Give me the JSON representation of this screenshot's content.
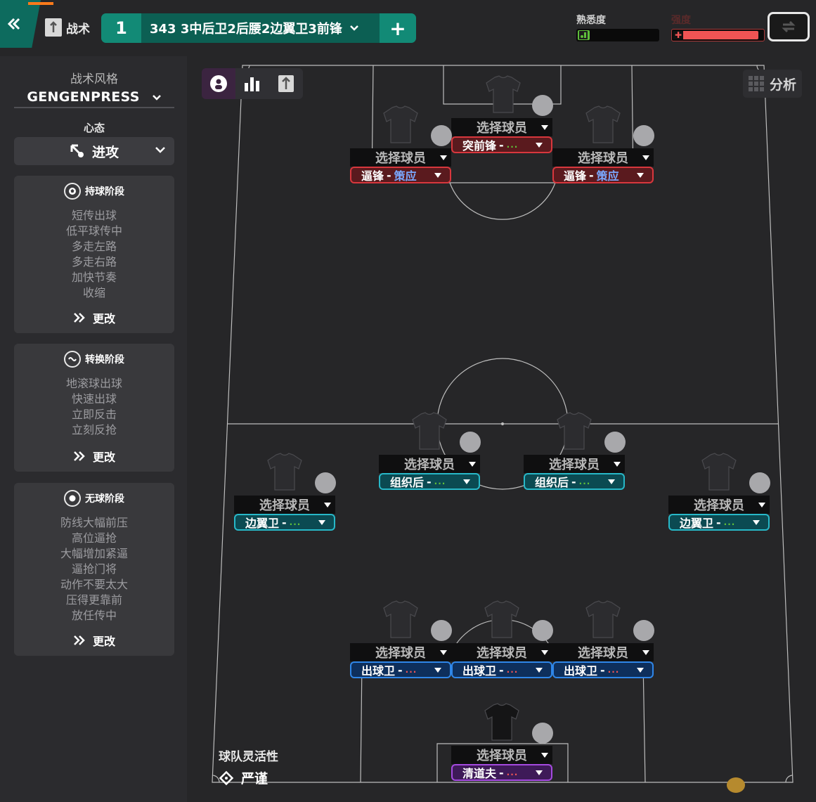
{
  "header": {
    "tab_label": "战术",
    "slot_number": "1",
    "formation_name": "343  3中后卫2后腰2边翼卫3前锋",
    "add_symbol": "+",
    "familiarity_label": "熟悉度",
    "familiarity_level": 0.15,
    "intensity_label": "强度",
    "intensity_level": 0.95,
    "accent_orange": "#ff7a1a",
    "brand_green": "#128a76"
  },
  "sidebar": {
    "style_caption": "战术风格",
    "style_value": "GENGENPRESS",
    "mentality_caption": "心态",
    "mentality_value": "进攻",
    "phases": [
      {
        "title": "持球阶段",
        "icon": "ball-icon",
        "items": [
          "短传出球",
          "低平球传中",
          "多走左路",
          "多走右路",
          "加快节奏",
          "收缩"
        ],
        "change_label": "更改"
      },
      {
        "title": "转换阶段",
        "icon": "transition-icon",
        "items": [
          "地滚球出球",
          "快速出球",
          "立即反击",
          "立刻反抢"
        ],
        "change_label": "更改"
      },
      {
        "title": "无球阶段",
        "icon": "defense-icon",
        "items": [
          "防线大幅前压",
          "高位逼抢",
          "大幅增加紧逼",
          "逼抢门将",
          "动作不要太大",
          "压得更靠前",
          "放任传中"
        ],
        "change_label": "更改"
      }
    ]
  },
  "pitch": {
    "analysis_label": "分析",
    "select_player": "选择球员",
    "team_fluidity_label": "球队灵活性",
    "team_fluidity_value": "严谨",
    "players": [
      {
        "id": "st",
        "role": "突前锋",
        "duty": "...",
        "duty_color": "#5ebf3a",
        "color": "red"
      },
      {
        "id": "lw",
        "role": "逼锋",
        "duty": "策应",
        "duty_color": "#7aa8ff",
        "color": "red"
      },
      {
        "id": "rw",
        "role": "逼锋",
        "duty": "策应",
        "duty_color": "#7aa8ff",
        "color": "red"
      },
      {
        "id": "lcm",
        "role": "组织后",
        "duty": "...",
        "duty_color": "#5ebf3a",
        "color": "teal"
      },
      {
        "id": "rcm",
        "role": "组织后",
        "duty": "...",
        "duty_color": "#5ebf3a",
        "color": "teal"
      },
      {
        "id": "lwb",
        "role": "边翼卫",
        "duty": "...",
        "duty_color": "#5ebf3a",
        "color": "teal"
      },
      {
        "id": "rwb",
        "role": "边翼卫",
        "duty": "...",
        "duty_color": "#5ebf3a",
        "color": "teal"
      },
      {
        "id": "lcb",
        "role": "出球卫",
        "duty": "...",
        "duty_color": "#ef5454",
        "color": "blue"
      },
      {
        "id": "cb",
        "role": "出球卫",
        "duty": "...",
        "duty_color": "#ef5454",
        "color": "blue"
      },
      {
        "id": "rcb",
        "role": "出球卫",
        "duty": "...",
        "duty_color": "#ef5454",
        "color": "blue"
      },
      {
        "id": "gk",
        "role": "清道夫",
        "duty": "...",
        "duty_color": "#ef5454",
        "color": "purple"
      }
    ]
  }
}
